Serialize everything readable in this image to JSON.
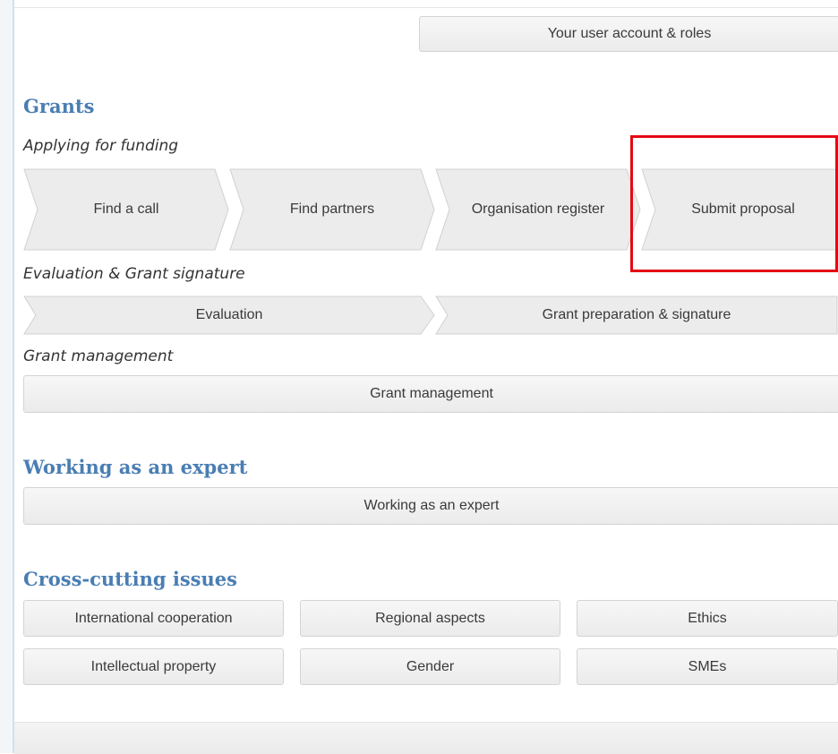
{
  "account": {
    "button_label": "Your user account & roles"
  },
  "grants": {
    "title": "Grants",
    "funding": {
      "subtitle": "Applying for funding",
      "steps": [
        "Find a call",
        "Find partners",
        "Organisation register",
        "Submit proposal"
      ]
    },
    "evaluation": {
      "subtitle": "Evaluation & Grant signature",
      "steps": [
        "Evaluation",
        "Grant preparation & signature"
      ]
    },
    "management": {
      "subtitle": "Grant management",
      "button_label": "Grant management"
    }
  },
  "expert": {
    "title": "Working as an expert",
    "button_label": "Working as an expert"
  },
  "cross_cutting": {
    "title": "Cross-cutting issues",
    "buttons": [
      "International cooperation",
      "Regional aspects",
      "Ethics",
      "Intellectual property",
      "Gender",
      "SMEs"
    ]
  },
  "colors": {
    "section_title": "#4a7eb3",
    "highlight": "#e50914",
    "button_fill": "#ececec"
  }
}
